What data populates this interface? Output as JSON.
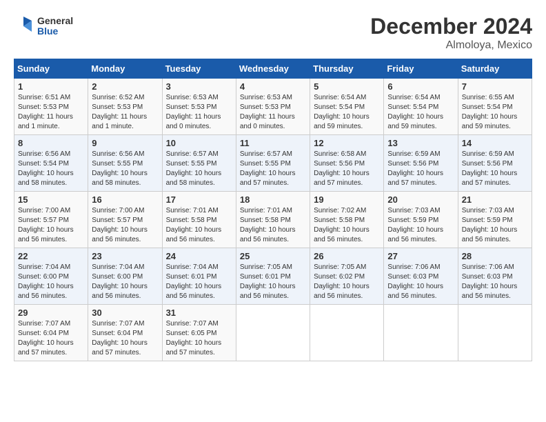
{
  "logo": {
    "line1": "General",
    "line2": "Blue"
  },
  "title": "December 2024",
  "subtitle": "Almoloya, Mexico",
  "header": {
    "days": [
      "Sunday",
      "Monday",
      "Tuesday",
      "Wednesday",
      "Thursday",
      "Friday",
      "Saturday"
    ]
  },
  "weeks": [
    [
      {
        "day": "1",
        "sunrise": "6:51 AM",
        "sunset": "5:53 PM",
        "daylight": "11 hours and 1 minute."
      },
      {
        "day": "2",
        "sunrise": "6:52 AM",
        "sunset": "5:53 PM",
        "daylight": "11 hours and 1 minute."
      },
      {
        "day": "3",
        "sunrise": "6:53 AM",
        "sunset": "5:53 PM",
        "daylight": "11 hours and 0 minutes."
      },
      {
        "day": "4",
        "sunrise": "6:53 AM",
        "sunset": "5:53 PM",
        "daylight": "11 hours and 0 minutes."
      },
      {
        "day": "5",
        "sunrise": "6:54 AM",
        "sunset": "5:54 PM",
        "daylight": "10 hours and 59 minutes."
      },
      {
        "day": "6",
        "sunrise": "6:54 AM",
        "sunset": "5:54 PM",
        "daylight": "10 hours and 59 minutes."
      },
      {
        "day": "7",
        "sunrise": "6:55 AM",
        "sunset": "5:54 PM",
        "daylight": "10 hours and 59 minutes."
      }
    ],
    [
      {
        "day": "8",
        "sunrise": "6:56 AM",
        "sunset": "5:54 PM",
        "daylight": "10 hours and 58 minutes."
      },
      {
        "day": "9",
        "sunrise": "6:56 AM",
        "sunset": "5:55 PM",
        "daylight": "10 hours and 58 minutes."
      },
      {
        "day": "10",
        "sunrise": "6:57 AM",
        "sunset": "5:55 PM",
        "daylight": "10 hours and 58 minutes."
      },
      {
        "day": "11",
        "sunrise": "6:57 AM",
        "sunset": "5:55 PM",
        "daylight": "10 hours and 57 minutes."
      },
      {
        "day": "12",
        "sunrise": "6:58 AM",
        "sunset": "5:56 PM",
        "daylight": "10 hours and 57 minutes."
      },
      {
        "day": "13",
        "sunrise": "6:59 AM",
        "sunset": "5:56 PM",
        "daylight": "10 hours and 57 minutes."
      },
      {
        "day": "14",
        "sunrise": "6:59 AM",
        "sunset": "5:56 PM",
        "daylight": "10 hours and 57 minutes."
      }
    ],
    [
      {
        "day": "15",
        "sunrise": "7:00 AM",
        "sunset": "5:57 PM",
        "daylight": "10 hours and 56 minutes."
      },
      {
        "day": "16",
        "sunrise": "7:00 AM",
        "sunset": "5:57 PM",
        "daylight": "10 hours and 56 minutes."
      },
      {
        "day": "17",
        "sunrise": "7:01 AM",
        "sunset": "5:58 PM",
        "daylight": "10 hours and 56 minutes."
      },
      {
        "day": "18",
        "sunrise": "7:01 AM",
        "sunset": "5:58 PM",
        "daylight": "10 hours and 56 minutes."
      },
      {
        "day": "19",
        "sunrise": "7:02 AM",
        "sunset": "5:58 PM",
        "daylight": "10 hours and 56 minutes."
      },
      {
        "day": "20",
        "sunrise": "7:03 AM",
        "sunset": "5:59 PM",
        "daylight": "10 hours and 56 minutes."
      },
      {
        "day": "21",
        "sunrise": "7:03 AM",
        "sunset": "5:59 PM",
        "daylight": "10 hours and 56 minutes."
      }
    ],
    [
      {
        "day": "22",
        "sunrise": "7:04 AM",
        "sunset": "6:00 PM",
        "daylight": "10 hours and 56 minutes."
      },
      {
        "day": "23",
        "sunrise": "7:04 AM",
        "sunset": "6:00 PM",
        "daylight": "10 hours and 56 minutes."
      },
      {
        "day": "24",
        "sunrise": "7:04 AM",
        "sunset": "6:01 PM",
        "daylight": "10 hours and 56 minutes."
      },
      {
        "day": "25",
        "sunrise": "7:05 AM",
        "sunset": "6:01 PM",
        "daylight": "10 hours and 56 minutes."
      },
      {
        "day": "26",
        "sunrise": "7:05 AM",
        "sunset": "6:02 PM",
        "daylight": "10 hours and 56 minutes."
      },
      {
        "day": "27",
        "sunrise": "7:06 AM",
        "sunset": "6:03 PM",
        "daylight": "10 hours and 56 minutes."
      },
      {
        "day": "28",
        "sunrise": "7:06 AM",
        "sunset": "6:03 PM",
        "daylight": "10 hours and 56 minutes."
      }
    ],
    [
      {
        "day": "29",
        "sunrise": "7:07 AM",
        "sunset": "6:04 PM",
        "daylight": "10 hours and 57 minutes."
      },
      {
        "day": "30",
        "sunrise": "7:07 AM",
        "sunset": "6:04 PM",
        "daylight": "10 hours and 57 minutes."
      },
      {
        "day": "31",
        "sunrise": "7:07 AM",
        "sunset": "6:05 PM",
        "daylight": "10 hours and 57 minutes."
      },
      null,
      null,
      null,
      null
    ]
  ]
}
